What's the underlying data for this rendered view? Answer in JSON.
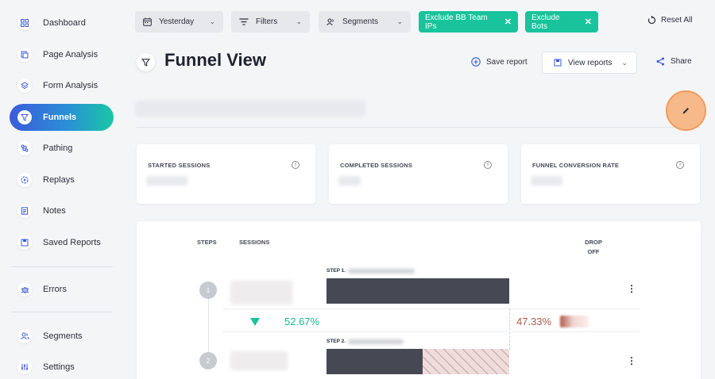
{
  "sidebar": {
    "items": [
      {
        "label": "Dashboard",
        "icon": "dashboard-icon"
      },
      {
        "label": "Page Analysis",
        "icon": "page-analysis-icon"
      },
      {
        "label": "Form Analysis",
        "icon": "form-analysis-icon"
      },
      {
        "label": "Funnels",
        "icon": "funnel-icon",
        "active": true
      },
      {
        "label": "Pathing",
        "icon": "pathing-icon"
      },
      {
        "label": "Replays",
        "icon": "replay-icon"
      },
      {
        "label": "Notes",
        "icon": "notes-icon"
      },
      {
        "label": "Saved Reports",
        "icon": "saved-reports-icon"
      },
      {
        "label": "Errors",
        "icon": "bug-icon"
      },
      {
        "label": "Segments",
        "icon": "segments-icon"
      },
      {
        "label": "Settings",
        "icon": "settings-icon"
      }
    ]
  },
  "topbar": {
    "date_filter": "Yesterday",
    "filters": "Filters",
    "segments": "Segments",
    "chip1": "Exclude BB Team IPs",
    "chip2": "Exclude Bots",
    "reset": "Reset All"
  },
  "header": {
    "title": "Funnel View",
    "save_report": "Save report",
    "view_reports": "View reports",
    "share": "Share"
  },
  "stats": {
    "started": "STARTED SESSIONS",
    "completed": "COMPLETED SESSIONS",
    "conversion": "FUNNEL CONVERSION RATE"
  },
  "funnel": {
    "col_steps": "STEPS",
    "col_sessions": "SESSIONS",
    "col_drop": "DROP",
    "col_off": "OFF",
    "steps": [
      {
        "num": "1",
        "label": "STEP 1."
      },
      {
        "num": "2",
        "label": "STEP 2."
      }
    ],
    "conversion_pct": "52.67%",
    "dropoff_pct": "47.33%",
    "step2_fill": 0.5267
  },
  "colors": {
    "accent_green": "#19c39c",
    "active_gradient_start": "#3b5bdb",
    "drop_color": "#b05a4b",
    "bar_color": "#464953"
  }
}
